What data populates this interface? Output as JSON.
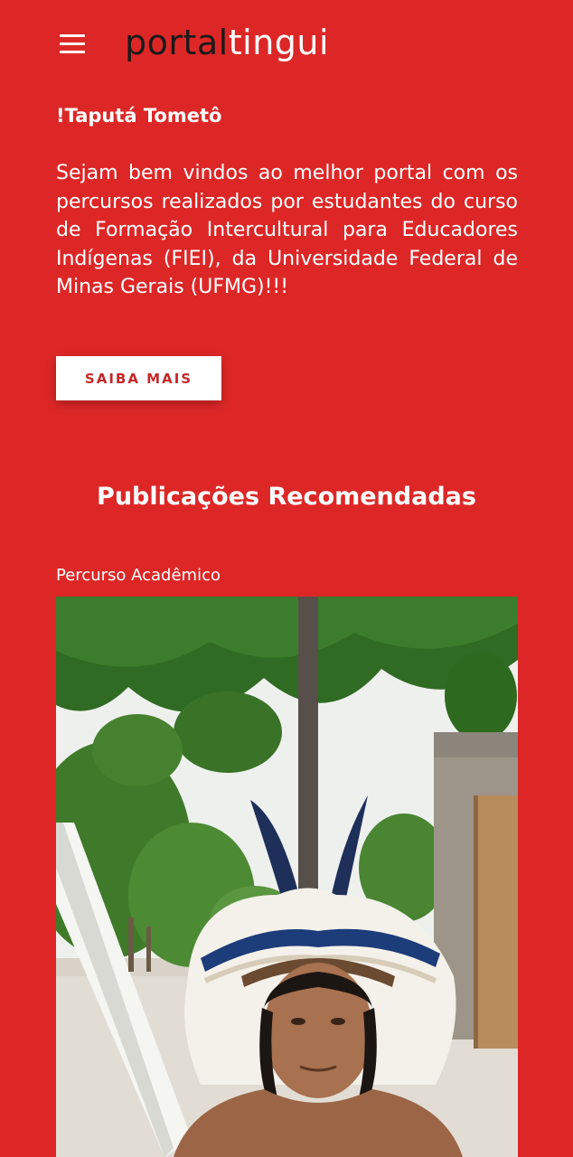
{
  "header": {
    "logo_part1": "portal",
    "logo_part2": "tingui"
  },
  "hero": {
    "greeting": "!Taputá Tometô",
    "intro": "Sejam bem vindos ao melhor portal com os percursos realizados por estudantes do curso de Formação Intercultural para Educadores Indígenas (FIEI), da Universidade Federal de Minas Gerais (UFMG)!!!",
    "cta_label": "SAIBA MAIS"
  },
  "recommended": {
    "title": "Publicações Recomendadas",
    "post": {
      "category": "Percurso Acadêmico"
    }
  },
  "colors": {
    "background": "#dd2727",
    "logo_dark": "#1a1a1a",
    "button_text": "#c62828"
  },
  "icons": {
    "menu": "hamburger-menu-icon"
  }
}
